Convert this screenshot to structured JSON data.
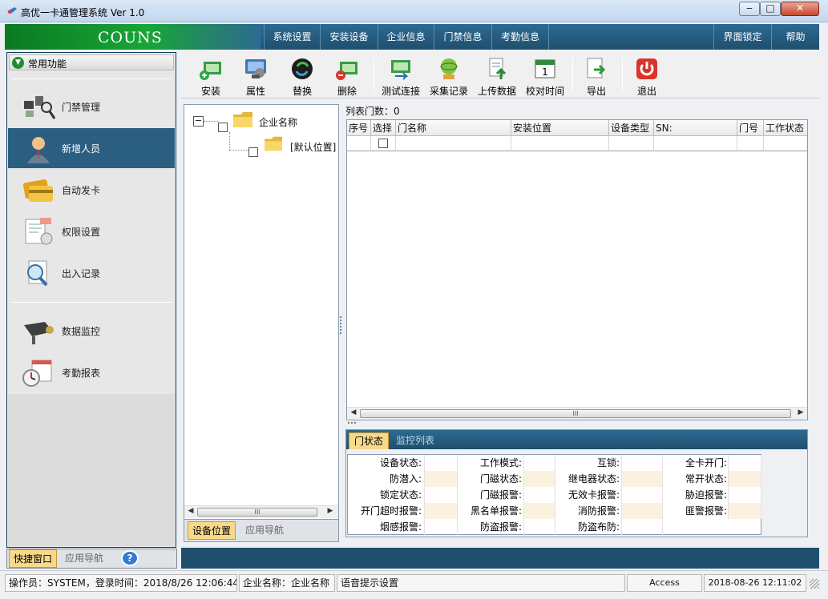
{
  "window": {
    "title": "高优一卡通管理系统 Ver 1.0",
    "min": "‒",
    "max": "□",
    "close": "✕"
  },
  "brand": "COUNS",
  "menu": [
    "系统设置",
    "安装设备",
    "企业信息",
    "门禁信息",
    "考勤信息",
    "界面锁定",
    "帮助"
  ],
  "left": {
    "header": "常用功能",
    "items": [
      "门禁管理",
      "新增人员",
      "自动发卡",
      "权限设置",
      "出入记录",
      "数据监控",
      "考勤报表"
    ],
    "bottom_tabs": [
      "快捷窗口",
      "应用导航"
    ],
    "help_icon": "?"
  },
  "toolbar": [
    "安装",
    "属性",
    "替换",
    "删除",
    "测试连接",
    "采集记录",
    "上传数据",
    "校对时间",
    "导出",
    "退出"
  ],
  "tree": {
    "root": "企业名称",
    "child": "[默认位置]",
    "collapse": "−",
    "scroll_thumb": "III",
    "tabs": [
      "设备位置",
      "应用导航"
    ]
  },
  "grid": {
    "count_label": "列表门数：0",
    "columns": [
      "序号",
      "选择",
      "门名称",
      "安装位置",
      "设备类型",
      "SN:",
      "门号",
      "工作状态"
    ],
    "scroll_thumb": "III"
  },
  "status": {
    "tabs": [
      "门状态",
      "监控列表"
    ],
    "rows": [
      [
        "设备状态:",
        "工作模式:",
        "互锁:",
        "全卡开门:"
      ],
      [
        "防潜入:",
        "门磁状态:",
        "继电器状态:",
        "常开状态:"
      ],
      [
        "锁定状态:",
        "门磁报警:",
        "无效卡报警:",
        "胁迫报警:"
      ],
      [
        "开门超时报警:",
        "黑名单报警:",
        "消防报警:",
        "匪警报警:"
      ],
      [
        "烟感报警:",
        "防盗报警:",
        "防盗布防:",
        ""
      ]
    ]
  },
  "statusbar": {
    "operator": "操作员：SYSTEM，登录时间：2018/8/26 12:06:44。",
    "company": "企业名称：企业名称",
    "voice": "语音提示设置",
    "db": "Access",
    "datetime": "2018-08-26 12:11:02"
  },
  "colors": {
    "accent": "#2b5f82",
    "brand_green": "#18a536",
    "tab_active": "#f7d98a"
  }
}
